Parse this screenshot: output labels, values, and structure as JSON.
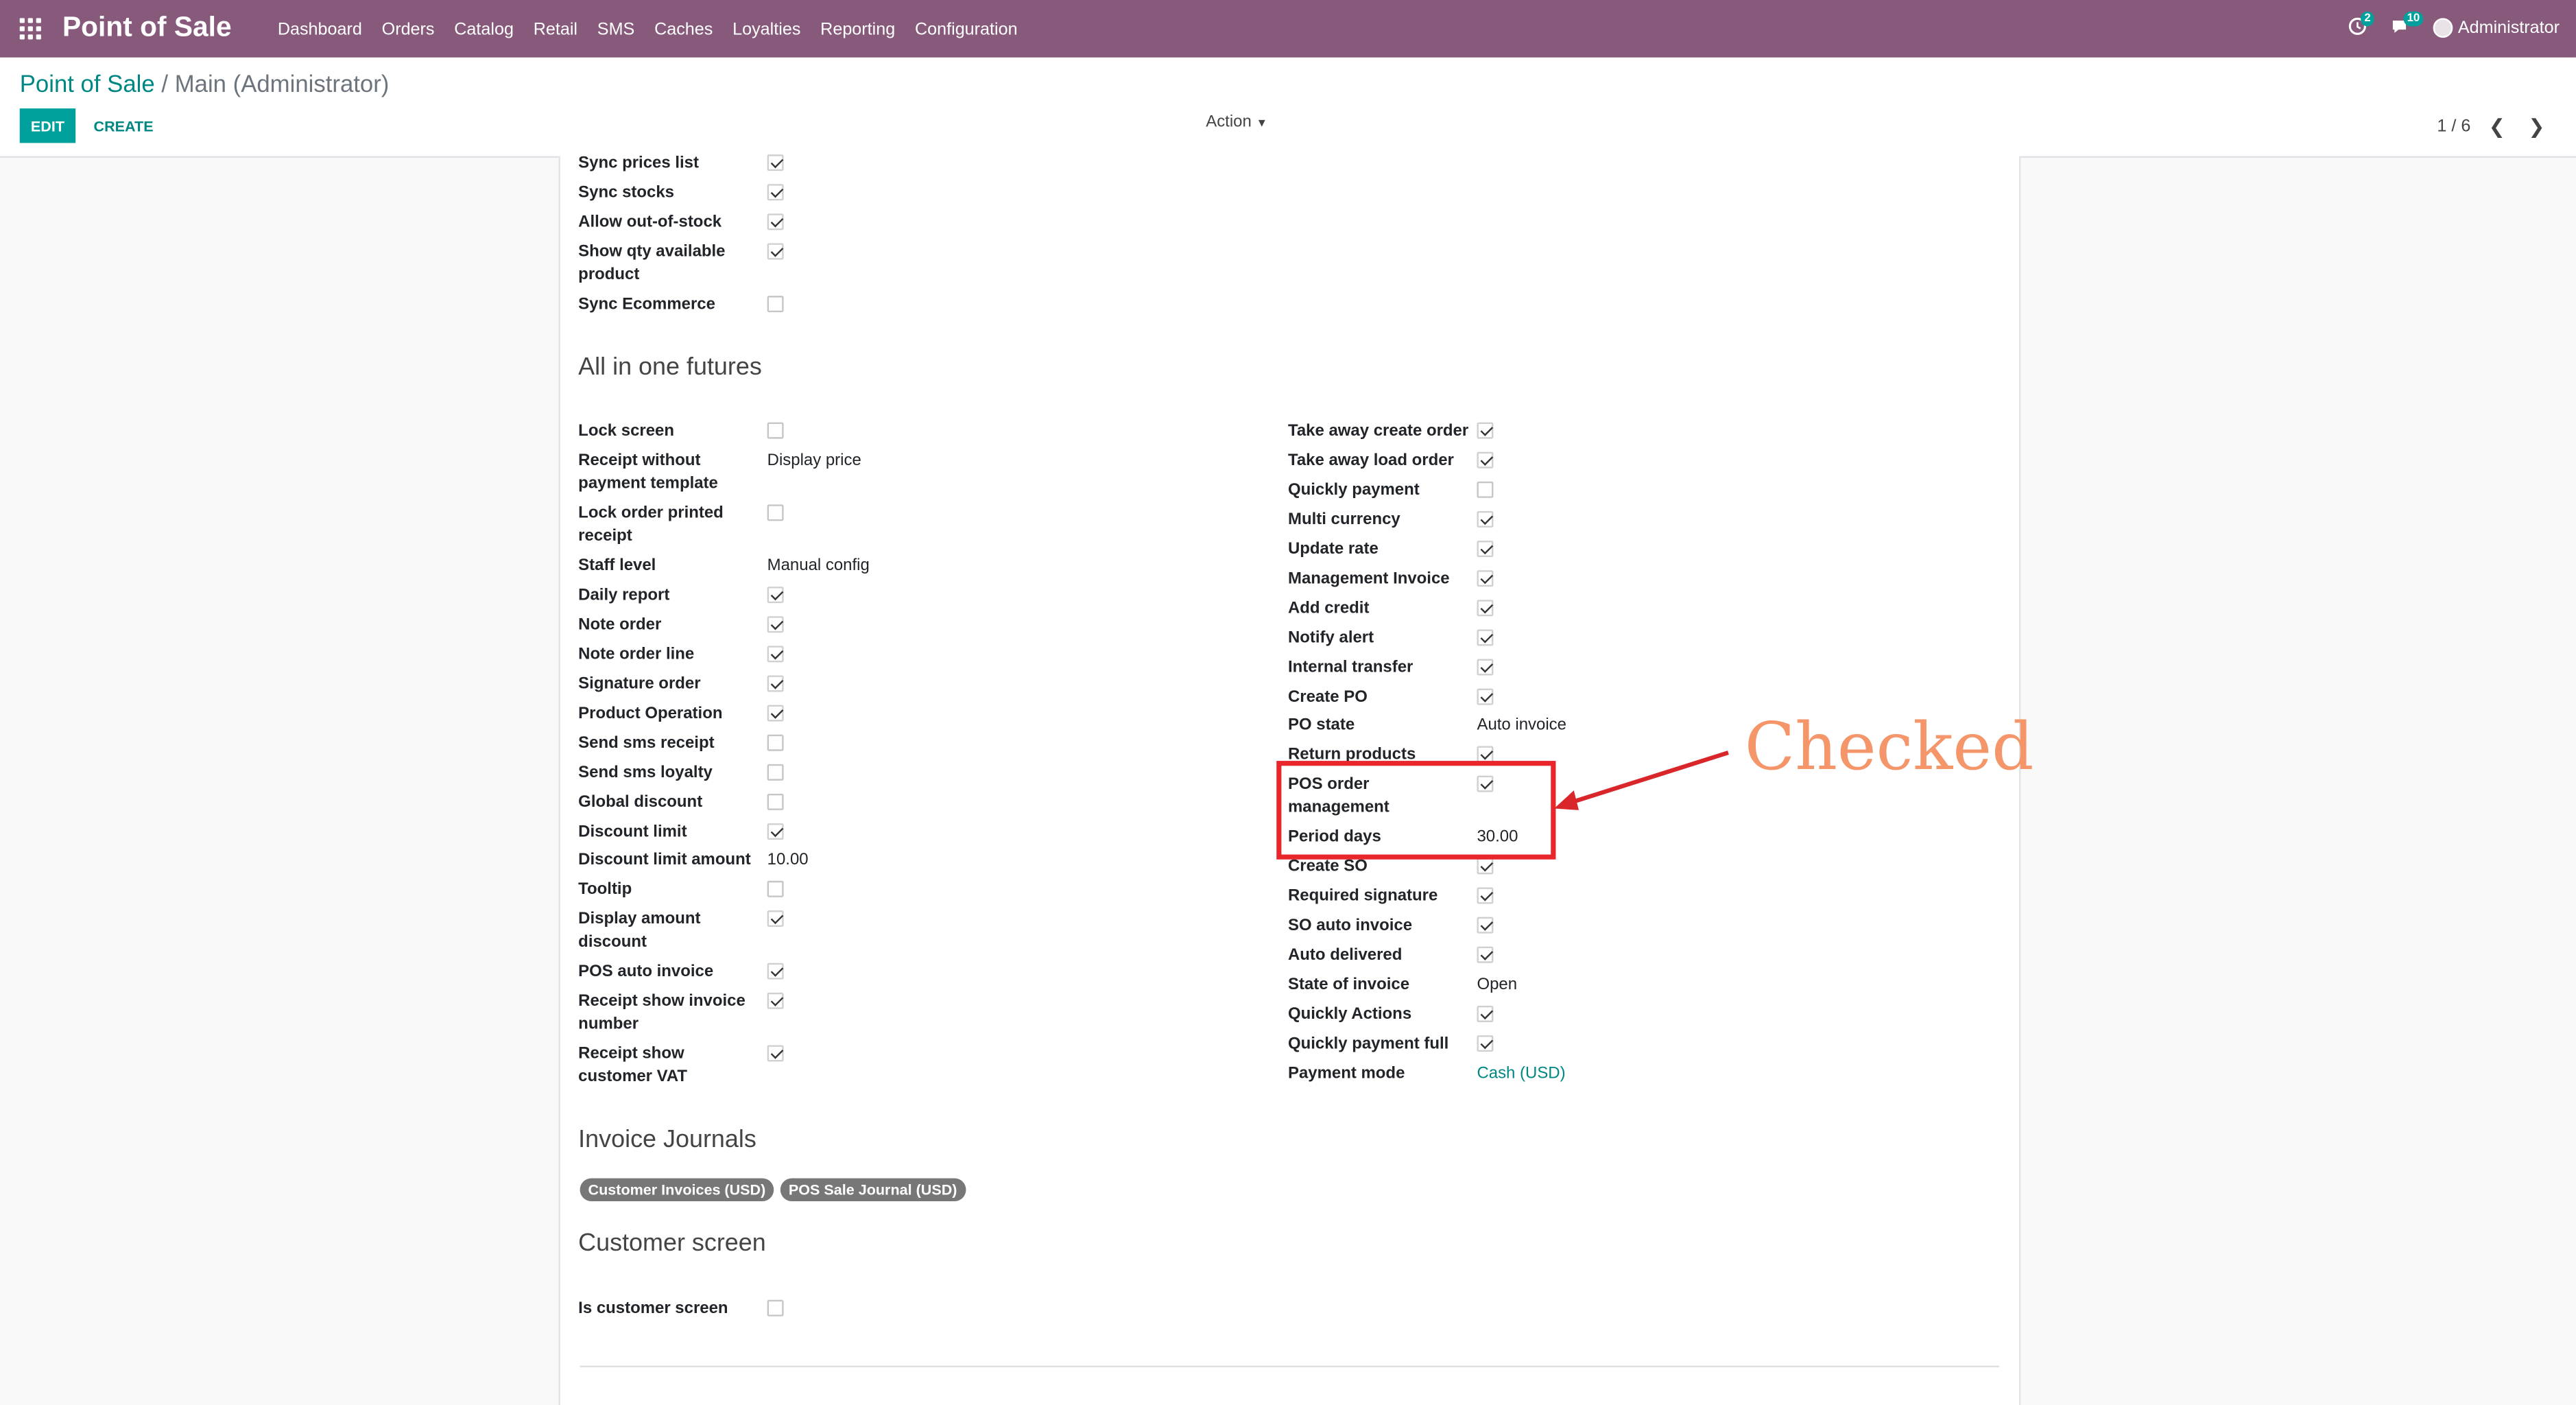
{
  "navbar": {
    "brand": "Point of Sale",
    "menu": [
      "Dashboard",
      "Orders",
      "Catalog",
      "Retail",
      "SMS",
      "Caches",
      "Loyalties",
      "Reporting",
      "Configuration"
    ],
    "activity_badge": "2",
    "messages_badge": "10",
    "user": "Administrator"
  },
  "control": {
    "breadcrumb_root": "Point of Sale",
    "breadcrumb_sep": "/",
    "breadcrumb_current": "Main (Administrator)",
    "edit_label": "EDIT",
    "create_label": "CREATE",
    "action_label": "Action",
    "pager": "1 / 6"
  },
  "sync_fields": [
    {
      "label": "Sync prices list",
      "checked": true
    },
    {
      "label": "Sync stocks",
      "checked": true
    },
    {
      "label": "Allow out-of-stock",
      "checked": true
    },
    {
      "label": "Show qty available\nproduct",
      "checked": true
    },
    {
      "label": "Sync Ecommerce",
      "checked": false
    }
  ],
  "section_all_in_one": "All in one futures",
  "left_fields": [
    {
      "label": "Lock screen",
      "checked": false
    },
    {
      "label": "Receipt without\npayment template",
      "value": "Display price"
    },
    {
      "label": "Lock order printed\nreceipt",
      "checked": false
    },
    {
      "label": "Staff level",
      "value": "Manual config"
    },
    {
      "label": "Daily report",
      "checked": true
    },
    {
      "label": "Note order",
      "checked": true
    },
    {
      "label": "Note order line",
      "checked": true
    },
    {
      "label": "Signature order",
      "checked": true
    },
    {
      "label": "Product Operation",
      "checked": true
    },
    {
      "label": "Send sms receipt",
      "checked": false
    },
    {
      "label": "Send sms loyalty",
      "checked": false
    },
    {
      "label": "Global discount",
      "checked": false
    },
    {
      "label": "Discount limit",
      "checked": true
    },
    {
      "label": "Discount limit amount",
      "value": "10.00"
    },
    {
      "label": "Tooltip",
      "checked": false
    },
    {
      "label": "Display amount\ndiscount",
      "checked": true
    },
    {
      "label": "POS auto invoice",
      "checked": true
    },
    {
      "label": "Receipt show invoice\nnumber",
      "checked": true
    },
    {
      "label": "Receipt show\ncustomer VAT",
      "checked": true
    }
  ],
  "right_fields": [
    {
      "label": "Take away create order",
      "checked": true
    },
    {
      "label": "Take away load order",
      "checked": true
    },
    {
      "label": "Quickly payment",
      "checked": false
    },
    {
      "label": "Multi currency",
      "checked": true
    },
    {
      "label": "Update rate",
      "checked": true
    },
    {
      "label": "Management Invoice",
      "checked": true
    },
    {
      "label": "Add credit",
      "checked": true
    },
    {
      "label": "Notify alert",
      "checked": true
    },
    {
      "label": "Internal transfer",
      "checked": true
    },
    {
      "label": "Create PO",
      "checked": true
    },
    {
      "label": "PO state",
      "value": "Auto invoice"
    },
    {
      "label": "Return products",
      "checked": true
    },
    {
      "label": "POS order\nmanagement",
      "checked": true
    },
    {
      "label": "Period days",
      "value": "30.00"
    },
    {
      "label": "Create SO",
      "checked": true
    },
    {
      "label": "Required signature",
      "checked": true
    },
    {
      "label": "SO auto invoice",
      "checked": true
    },
    {
      "label": "Auto delivered",
      "checked": true
    },
    {
      "label": "State of invoice",
      "value": "Open"
    },
    {
      "label": "Quickly Actions",
      "checked": true
    },
    {
      "label": "Quickly payment full",
      "checked": true
    },
    {
      "label": "Payment mode",
      "value": "Cash (USD)",
      "link": true
    }
  ],
  "section_invoice_journals": "Invoice Journals",
  "invoice_journals": [
    "Customer Invoices (USD)",
    "POS Sale Journal (USD)"
  ],
  "section_customer_screen": "Customer screen",
  "customer_screen_fields": [
    {
      "label": "Is customer screen",
      "checked": false
    }
  ],
  "annotation": {
    "text": "Checked",
    "color": "#f4956a",
    "box_color": "#e8262b"
  }
}
